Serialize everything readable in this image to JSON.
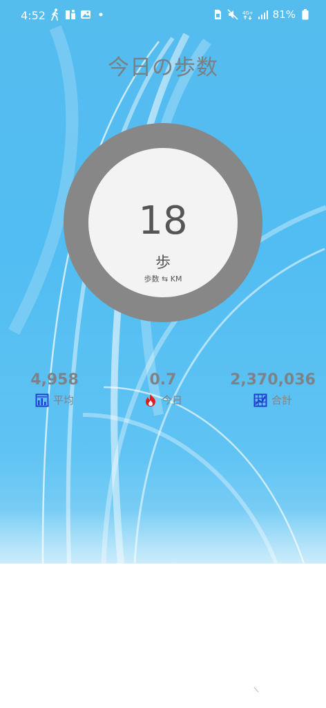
{
  "status_bar": {
    "time": "4:52",
    "left_icons": [
      "walking-icon",
      "cleaner-app-icon",
      "gallery-icon",
      "notification-dot-icon"
    ],
    "right_icons": [
      "sim-lock-icon",
      "mute-icon",
      "lte-icon",
      "signal-icon",
      "battery-icon"
    ],
    "battery": "81%",
    "network": "4G+"
  },
  "header": {
    "title": "今日の歩数"
  },
  "progress": {
    "value": "18",
    "unit": "歩",
    "toggle_label": "歩数 ⇆ KM",
    "fraction": 0
  },
  "stats": [
    {
      "value": "4,958",
      "label": "平均",
      "icon": "average-chart-icon",
      "icon_color": "#1f3fd0"
    },
    {
      "value": "0.7",
      "label": "今日",
      "icon": "fire-icon",
      "icon_color": "#e01e1e"
    },
    {
      "value": "2,370,036",
      "label": "合計",
      "icon": "total-chart-icon",
      "icon_color": "#1f3fd0"
    }
  ],
  "colors": {
    "sky": "#55bcee",
    "ring": "#878787",
    "ring_center": "#f3f3f3",
    "text_gray": "#7a7f85"
  }
}
